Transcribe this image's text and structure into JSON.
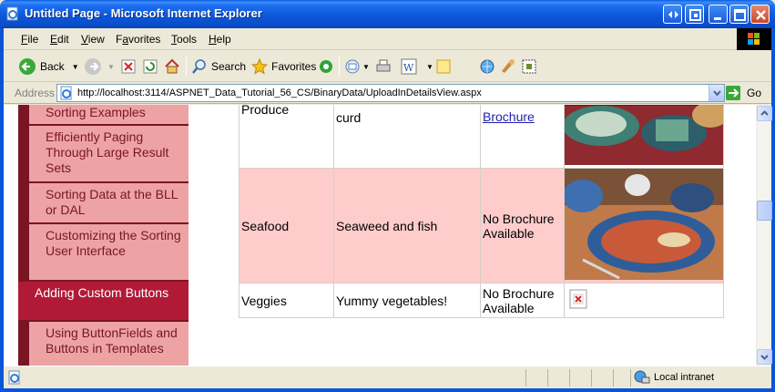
{
  "window": {
    "title": "Untitled Page - Microsoft Internet Explorer"
  },
  "menu": [
    "File",
    "Edit",
    "View",
    "Favorites",
    "Tools",
    "Help"
  ],
  "menu_underline": [
    "F",
    "E",
    "V",
    "a",
    "T",
    "H"
  ],
  "toolbar": {
    "back_label": "Back",
    "search_label": "Search",
    "favorites_label": "Favorites"
  },
  "address": {
    "label": "Address",
    "url": "http://localhost:3114/ASPNET_Data_Tutorial_56_CS/BinaryData/UploadInDetailsView.aspx",
    "go_label": "Go"
  },
  "nav": [
    {
      "label": "Sorting Examples",
      "selected": false
    },
    {
      "label": "Efficiently Paging Through Large Result Sets",
      "selected": false
    },
    {
      "label": "Sorting Data at the BLL or DAL",
      "selected": false
    },
    {
      "label": "Customizing the Sorting User Interface",
      "selected": false
    },
    {
      "label": "Adding Custom Buttons",
      "selected": true
    },
    {
      "label": "Using ButtonFields and Buttons in Templates",
      "selected": false
    }
  ],
  "grid": {
    "rows": [
      {
        "category": "Produce",
        "description": "curd",
        "brochure": "Brochure",
        "brochure_is_link": true,
        "image": "produce-photo"
      },
      {
        "category": "Seafood",
        "description": "Seaweed and fish",
        "brochure": "No Brochure Available",
        "brochure_is_link": false,
        "image": "seafood-photo"
      },
      {
        "category": "Veggies",
        "description": "Yummy vegetables!",
        "brochure": "No Brochure Available",
        "brochure_is_link": false,
        "image": "broken-image-icon"
      }
    ]
  },
  "status": {
    "zone": "Local intranet"
  },
  "colors": {
    "nav_bg": "#eda3a3",
    "nav_text": "#7a1524",
    "nav_selected": "#b11a37",
    "row_alt": "#ffcccc",
    "titlebar": "#0b55d8"
  }
}
